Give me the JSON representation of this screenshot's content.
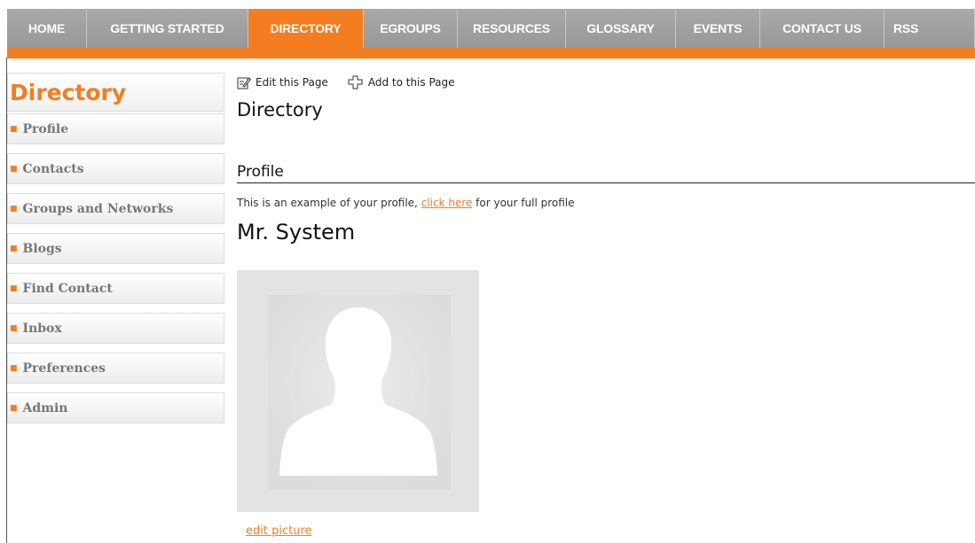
{
  "nav": {
    "tabs": [
      {
        "label": "HOME",
        "active": false
      },
      {
        "label": "GETTING STARTED",
        "active": false
      },
      {
        "label": "DIRECTORY",
        "active": true
      },
      {
        "label": "EGROUPS",
        "active": false
      },
      {
        "label": "RESOURCES",
        "active": false
      },
      {
        "label": "GLOSSARY",
        "active": false
      },
      {
        "label": "EVENTS",
        "active": false
      },
      {
        "label": "CONTACT US",
        "active": false
      },
      {
        "label": "RSS",
        "active": false
      }
    ]
  },
  "sidebar": {
    "title": "Directory",
    "items": [
      {
        "label": "Profile"
      },
      {
        "label": "Contacts"
      },
      {
        "label": "Groups and Networks"
      },
      {
        "label": "Blogs"
      },
      {
        "label": "Find Contact"
      },
      {
        "label": "Inbox"
      },
      {
        "label": "Preferences"
      },
      {
        "label": "Admin"
      }
    ]
  },
  "toolbar": {
    "edit_label": "Edit this Page",
    "add_label": "Add to this Page"
  },
  "main": {
    "title": "Directory",
    "section_title": "Profile",
    "profile_text_before": "This is an example of your profile, ",
    "profile_link": "click here",
    "profile_text_after": " for your full profile",
    "name": "Mr. System",
    "edit_picture": "edit picture"
  },
  "colors": {
    "accent": "#f47d20",
    "tab_gray": "#a0a0a0"
  }
}
